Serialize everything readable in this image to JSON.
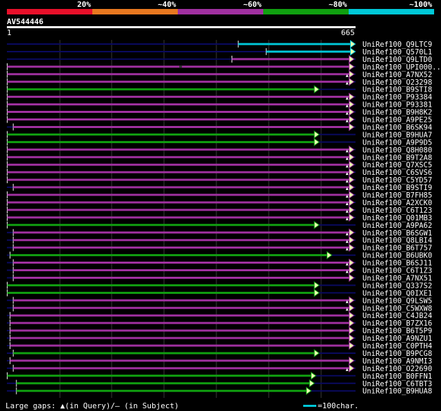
{
  "legend": {
    "labels": [
      "20%",
      "~40%",
      "~60%",
      "~80%",
      "~100%"
    ],
    "colors": [
      "#e8102a",
      "#e87820",
      "#a030a0",
      "#10a010",
      "#00c8d8"
    ]
  },
  "query": {
    "name": "AV544446",
    "start": "1",
    "end": "665"
  },
  "hits": [
    {
      "id": "UniRef100_Q9LTC9",
      "color_class": "~100%",
      "q_start": 370,
      "q_end": 1,
      "has_arrow": true,
      "gap_marks": []
    },
    {
      "id": "UniRef100_Q570L1",
      "color_class": "~100%",
      "q_start": 282,
      "q_end": 1,
      "has_arrow": true,
      "gap_marks": []
    },
    {
      "id": "UniRef100_Q9LTD0",
      "color_class": "~60%",
      "q_start": 390,
      "q_end": 5,
      "has_arrow": true,
      "gap_marks": []
    },
    {
      "id": "UniRef100_UPI000..",
      "color_class": "~60%",
      "q_start": 1099,
      "q_end": 5,
      "has_arrow": true,
      "gap_marks": [
        "s"
      ]
    },
    {
      "id": "UniRef100_A7NX52",
      "color_class": "~60%",
      "q_start": 1099,
      "q_end": 5,
      "has_arrow": true,
      "gap_marks": [
        "q"
      ]
    },
    {
      "id": "UniRef100_O23298",
      "color_class": "~60%",
      "q_start": 1099,
      "q_end": 5,
      "has_arrow": true,
      "gap_marks": [
        "q"
      ]
    },
    {
      "id": "UniRef100_B9STI8",
      "color_class": "~80%",
      "q_start": 1099,
      "q_end": 115,
      "has_arrow": true,
      "gap_marks": []
    },
    {
      "id": "UniRef100_P93384",
      "color_class": "~60%",
      "q_start": 1099,
      "q_end": 5,
      "has_arrow": true,
      "gap_marks": [
        "q"
      ]
    },
    {
      "id": "UniRef100_P93381",
      "color_class": "~60%",
      "q_start": 1099,
      "q_end": 5,
      "has_arrow": true,
      "gap_marks": [
        "q"
      ]
    },
    {
      "id": "UniRef100_B9H8K2",
      "color_class": "~60%",
      "q_start": 1099,
      "q_end": 5,
      "has_arrow": true,
      "gap_marks": [
        "q"
      ]
    },
    {
      "id": "UniRef100_A9PE25",
      "color_class": "~60%",
      "q_start": 1099,
      "q_end": 5,
      "has_arrow": true,
      "gap_marks": [
        "q"
      ]
    },
    {
      "id": "UniRef100_B6SK94",
      "color_class": "~60%",
      "q_start": 1080,
      "q_end": 5,
      "has_arrow": true,
      "gap_marks": []
    },
    {
      "id": "UniRef100_B9HUA7",
      "color_class": "~80%",
      "q_start": 1099,
      "q_end": 115,
      "has_arrow": true,
      "gap_marks": []
    },
    {
      "id": "UniRef100_A9P9D5",
      "color_class": "~80%",
      "q_start": 1099,
      "q_end": 115,
      "has_arrow": true,
      "gap_marks": []
    },
    {
      "id": "UniRef100_Q8H080",
      "color_class": "~60%",
      "q_start": 1099,
      "q_end": 5,
      "has_arrow": true,
      "gap_marks": [
        "q"
      ]
    },
    {
      "id": "UniRef100_B9T2A8",
      "color_class": "~60%",
      "q_start": 1099,
      "q_end": 5,
      "has_arrow": true,
      "gap_marks": [
        "q"
      ]
    },
    {
      "id": "UniRef100_Q7XSC5",
      "color_class": "~60%",
      "q_start": 1099,
      "q_end": 5,
      "has_arrow": true,
      "gap_marks": [
        "q"
      ]
    },
    {
      "id": "UniRef100_C6SVS6",
      "color_class": "~60%",
      "q_start": 1099,
      "q_end": 5,
      "has_arrow": true,
      "gap_marks": [
        "q"
      ]
    },
    {
      "id": "UniRef100_C5YD57",
      "color_class": "~60%",
      "q_start": 1099,
      "q_end": 5,
      "has_arrow": true,
      "gap_marks": [
        "q"
      ]
    },
    {
      "id": "UniRef100_B9STI9",
      "color_class": "~60%",
      "q_start": 1080,
      "q_end": 5,
      "has_arrow": true,
      "gap_marks": [
        "q"
      ]
    },
    {
      "id": "UniRef100_B7FH85",
      "color_class": "~60%",
      "q_start": 1099,
      "q_end": 5,
      "has_arrow": true,
      "gap_marks": [
        "q"
      ]
    },
    {
      "id": "UniRef100_A2XCK0",
      "color_class": "~60%",
      "q_start": 1099,
      "q_end": 5,
      "has_arrow": true,
      "gap_marks": [
        "q"
      ]
    },
    {
      "id": "UniRef100_C6T123",
      "color_class": "~60%",
      "q_start": 1099,
      "q_end": 5,
      "has_arrow": true,
      "gap_marks": [
        "q"
      ]
    },
    {
      "id": "UniRef100_Q01MB3",
      "color_class": "~60%",
      "q_start": 1099,
      "q_end": 5,
      "has_arrow": true,
      "gap_marks": [
        "q"
      ]
    },
    {
      "id": "UniRef100_A9PA62",
      "color_class": "~80%",
      "q_start": 1099,
      "q_end": 115,
      "has_arrow": true,
      "gap_marks": []
    },
    {
      "id": "UniRef100_B6SGW1",
      "color_class": "~60%",
      "q_start": 1080,
      "q_end": 5,
      "has_arrow": true,
      "gap_marks": [
        "q"
      ]
    },
    {
      "id": "UniRef100_Q8LBI4",
      "color_class": "~60%",
      "q_start": 1080,
      "q_end": 5,
      "has_arrow": true,
      "gap_marks": [
        "q"
      ]
    },
    {
      "id": "UniRef100_B6T757",
      "color_class": "~60%",
      "q_start": 1080,
      "q_end": 5,
      "has_arrow": true,
      "gap_marks": [
        "q"
      ]
    },
    {
      "id": "UniRef100_B6UBK0",
      "color_class": "~80%",
      "q_start": 1090,
      "q_end": 75,
      "has_arrow": true,
      "gap_marks": []
    },
    {
      "id": "UniRef100_B6SJ11",
      "color_class": "~60%",
      "q_start": 1080,
      "q_end": 5,
      "has_arrow": true,
      "gap_marks": [
        "q"
      ]
    },
    {
      "id": "UniRef100_C6T1Z3",
      "color_class": "~60%",
      "q_start": 1080,
      "q_end": 5,
      "has_arrow": true,
      "gap_marks": [
        "q"
      ]
    },
    {
      "id": "UniRef100_A7NX51",
      "color_class": "~60%",
      "q_start": 1080,
      "q_end": 5,
      "has_arrow": true,
      "gap_marks": []
    },
    {
      "id": "UniRef100_Q337S2",
      "color_class": "~80%",
      "q_start": 1099,
      "q_end": 115,
      "has_arrow": true,
      "gap_marks": []
    },
    {
      "id": "UniRef100_Q0IXE1",
      "color_class": "~80%",
      "q_start": 1099,
      "q_end": 115,
      "has_arrow": true,
      "gap_marks": []
    },
    {
      "id": "UniRef100_Q9LSW5",
      "color_class": "~60%",
      "q_start": 1080,
      "q_end": 5,
      "has_arrow": true,
      "gap_marks": [
        "q"
      ]
    },
    {
      "id": "UniRef100_C5WXW8",
      "color_class": "~60%",
      "q_start": 1080,
      "q_end": 5,
      "has_arrow": true,
      "gap_marks": [
        "q"
      ]
    },
    {
      "id": "UniRef100_C4JB24",
      "color_class": "~60%",
      "q_start": 1090,
      "q_end": 5,
      "has_arrow": true,
      "gap_marks": []
    },
    {
      "id": "UniRef100_B7ZX16",
      "color_class": "~60%",
      "q_start": 1090,
      "q_end": 5,
      "has_arrow": true,
      "gap_marks": []
    },
    {
      "id": "UniRef100_B6T5P9",
      "color_class": "~60%",
      "q_start": 1090,
      "q_end": 5,
      "has_arrow": true,
      "gap_marks": []
    },
    {
      "id": "UniRef100_A9NZU1",
      "color_class": "~60%",
      "q_start": 1090,
      "q_end": 5,
      "has_arrow": true,
      "gap_marks": []
    },
    {
      "id": "UniRef100_C0PTH4",
      "color_class": "~60%",
      "q_start": 1090,
      "q_end": 5,
      "has_arrow": true,
      "gap_marks": []
    },
    {
      "id": "UniRef100_B9PCG8",
      "color_class": "~80%",
      "q_start": 1080,
      "q_end": 115,
      "has_arrow": true,
      "gap_marks": []
    },
    {
      "id": "UniRef100_A9NMI3",
      "color_class": "~60%",
      "q_start": 1090,
      "q_end": 5,
      "has_arrow": true,
      "gap_marks": []
    },
    {
      "id": "UniRef100_O22690",
      "color_class": "~60%",
      "q_start": 1080,
      "q_end": 5,
      "has_arrow": true,
      "gap_marks": [
        "q"
      ]
    },
    {
      "id": "UniRef100_B0FFN1",
      "color_class": "~80%",
      "q_start": 1099,
      "q_end": 125,
      "has_arrow": true,
      "gap_marks": []
    },
    {
      "id": "UniRef100_C6TBT3",
      "color_class": "~80%",
      "q_start": 1070,
      "q_end": 130,
      "has_arrow": true,
      "gap_marks": []
    },
    {
      "id": "UniRef100_B9HUA8",
      "color_class": "~80%",
      "q_start": 1070,
      "q_end": 140,
      "has_arrow": true,
      "gap_marks": []
    }
  ],
  "footer": {
    "gaps_label": "Large gaps: ▲(in Query)/– (in Subject)",
    "scale_label": "=100char."
  },
  "colors": {
    "background": "#000000",
    "grid": "#3a3a3a",
    "track": "#0a0a60",
    "text": "#ffffff",
    "arrow_fill": "#e8ffb0"
  }
}
